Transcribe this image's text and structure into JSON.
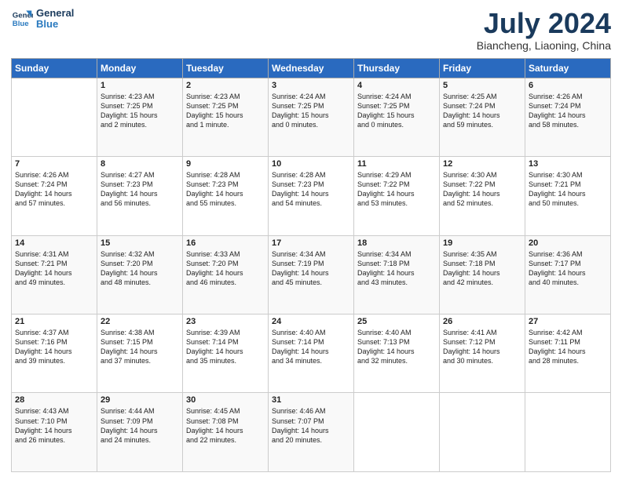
{
  "header": {
    "logo_line1": "General",
    "logo_line2": "Blue",
    "month": "July 2024",
    "location": "Biancheng, Liaoning, China"
  },
  "weekdays": [
    "Sunday",
    "Monday",
    "Tuesday",
    "Wednesday",
    "Thursday",
    "Friday",
    "Saturday"
  ],
  "weeks": [
    [
      {
        "day": "",
        "info": ""
      },
      {
        "day": "1",
        "info": "Sunrise: 4:23 AM\nSunset: 7:25 PM\nDaylight: 15 hours\nand 2 minutes."
      },
      {
        "day": "2",
        "info": "Sunrise: 4:23 AM\nSunset: 7:25 PM\nDaylight: 15 hours\nand 1 minute."
      },
      {
        "day": "3",
        "info": "Sunrise: 4:24 AM\nSunset: 7:25 PM\nDaylight: 15 hours\nand 0 minutes."
      },
      {
        "day": "4",
        "info": "Sunrise: 4:24 AM\nSunset: 7:25 PM\nDaylight: 15 hours\nand 0 minutes."
      },
      {
        "day": "5",
        "info": "Sunrise: 4:25 AM\nSunset: 7:24 PM\nDaylight: 14 hours\nand 59 minutes."
      },
      {
        "day": "6",
        "info": "Sunrise: 4:26 AM\nSunset: 7:24 PM\nDaylight: 14 hours\nand 58 minutes."
      }
    ],
    [
      {
        "day": "7",
        "info": "Sunrise: 4:26 AM\nSunset: 7:24 PM\nDaylight: 14 hours\nand 57 minutes."
      },
      {
        "day": "8",
        "info": "Sunrise: 4:27 AM\nSunset: 7:23 PM\nDaylight: 14 hours\nand 56 minutes."
      },
      {
        "day": "9",
        "info": "Sunrise: 4:28 AM\nSunset: 7:23 PM\nDaylight: 14 hours\nand 55 minutes."
      },
      {
        "day": "10",
        "info": "Sunrise: 4:28 AM\nSunset: 7:23 PM\nDaylight: 14 hours\nand 54 minutes."
      },
      {
        "day": "11",
        "info": "Sunrise: 4:29 AM\nSunset: 7:22 PM\nDaylight: 14 hours\nand 53 minutes."
      },
      {
        "day": "12",
        "info": "Sunrise: 4:30 AM\nSunset: 7:22 PM\nDaylight: 14 hours\nand 52 minutes."
      },
      {
        "day": "13",
        "info": "Sunrise: 4:30 AM\nSunset: 7:21 PM\nDaylight: 14 hours\nand 50 minutes."
      }
    ],
    [
      {
        "day": "14",
        "info": "Sunrise: 4:31 AM\nSunset: 7:21 PM\nDaylight: 14 hours\nand 49 minutes."
      },
      {
        "day": "15",
        "info": "Sunrise: 4:32 AM\nSunset: 7:20 PM\nDaylight: 14 hours\nand 48 minutes."
      },
      {
        "day": "16",
        "info": "Sunrise: 4:33 AM\nSunset: 7:20 PM\nDaylight: 14 hours\nand 46 minutes."
      },
      {
        "day": "17",
        "info": "Sunrise: 4:34 AM\nSunset: 7:19 PM\nDaylight: 14 hours\nand 45 minutes."
      },
      {
        "day": "18",
        "info": "Sunrise: 4:34 AM\nSunset: 7:18 PM\nDaylight: 14 hours\nand 43 minutes."
      },
      {
        "day": "19",
        "info": "Sunrise: 4:35 AM\nSunset: 7:18 PM\nDaylight: 14 hours\nand 42 minutes."
      },
      {
        "day": "20",
        "info": "Sunrise: 4:36 AM\nSunset: 7:17 PM\nDaylight: 14 hours\nand 40 minutes."
      }
    ],
    [
      {
        "day": "21",
        "info": "Sunrise: 4:37 AM\nSunset: 7:16 PM\nDaylight: 14 hours\nand 39 minutes."
      },
      {
        "day": "22",
        "info": "Sunrise: 4:38 AM\nSunset: 7:15 PM\nDaylight: 14 hours\nand 37 minutes."
      },
      {
        "day": "23",
        "info": "Sunrise: 4:39 AM\nSunset: 7:14 PM\nDaylight: 14 hours\nand 35 minutes."
      },
      {
        "day": "24",
        "info": "Sunrise: 4:40 AM\nSunset: 7:14 PM\nDaylight: 14 hours\nand 34 minutes."
      },
      {
        "day": "25",
        "info": "Sunrise: 4:40 AM\nSunset: 7:13 PM\nDaylight: 14 hours\nand 32 minutes."
      },
      {
        "day": "26",
        "info": "Sunrise: 4:41 AM\nSunset: 7:12 PM\nDaylight: 14 hours\nand 30 minutes."
      },
      {
        "day": "27",
        "info": "Sunrise: 4:42 AM\nSunset: 7:11 PM\nDaylight: 14 hours\nand 28 minutes."
      }
    ],
    [
      {
        "day": "28",
        "info": "Sunrise: 4:43 AM\nSunset: 7:10 PM\nDaylight: 14 hours\nand 26 minutes."
      },
      {
        "day": "29",
        "info": "Sunrise: 4:44 AM\nSunset: 7:09 PM\nDaylight: 14 hours\nand 24 minutes."
      },
      {
        "day": "30",
        "info": "Sunrise: 4:45 AM\nSunset: 7:08 PM\nDaylight: 14 hours\nand 22 minutes."
      },
      {
        "day": "31",
        "info": "Sunrise: 4:46 AM\nSunset: 7:07 PM\nDaylight: 14 hours\nand 20 minutes."
      },
      {
        "day": "",
        "info": ""
      },
      {
        "day": "",
        "info": ""
      },
      {
        "day": "",
        "info": ""
      }
    ]
  ]
}
